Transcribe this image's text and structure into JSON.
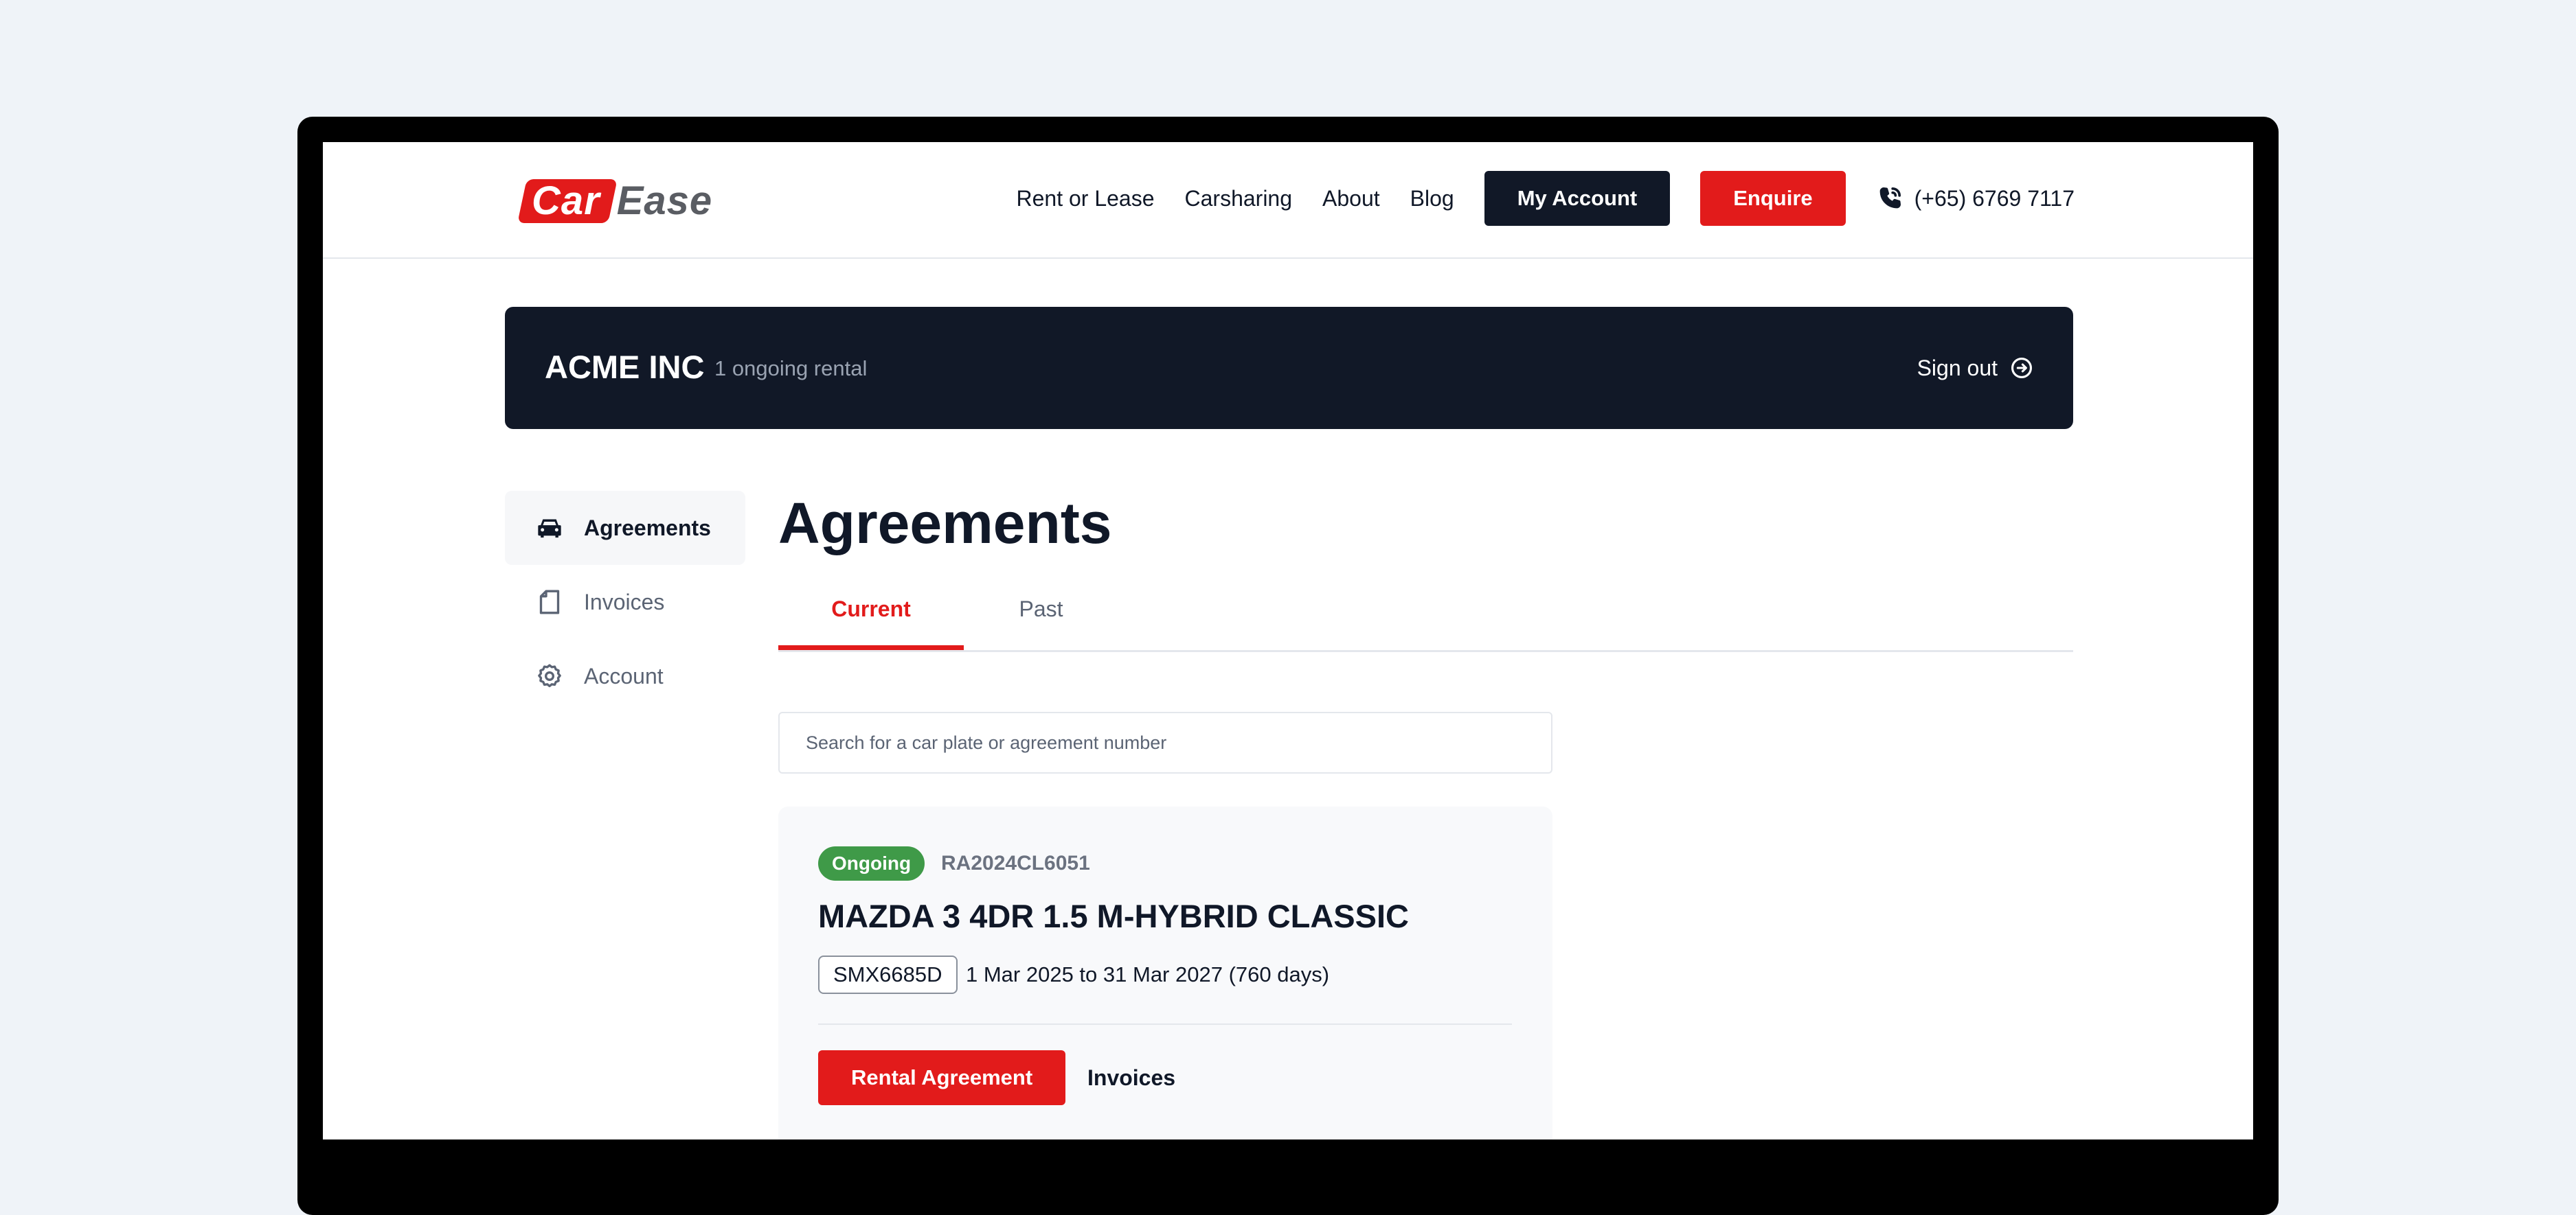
{
  "brand": {
    "logo_part1": "Car",
    "logo_part2": "Ease",
    "primary_color": "#e21b1b",
    "dark_color": "#111827"
  },
  "header": {
    "nav": [
      {
        "label": "Rent or Lease"
      },
      {
        "label": "Carsharing"
      },
      {
        "label": "About"
      },
      {
        "label": "Blog"
      }
    ],
    "my_account_label": "My Account",
    "enquire_label": "Enquire",
    "phone": "(+65) 6769 7117",
    "phone_icon": "phone-icon"
  },
  "account_banner": {
    "company": "ACME INC",
    "rentals_summary": "1 ongoing rental",
    "sign_out_label": "Sign out",
    "sign_out_icon": "arrow-circle-right-icon"
  },
  "sidebar": {
    "items": [
      {
        "label": "Agreements",
        "icon": "car-icon",
        "active": true
      },
      {
        "label": "Invoices",
        "icon": "document-icon",
        "active": false
      },
      {
        "label": "Account",
        "icon": "gear-icon",
        "active": false
      }
    ]
  },
  "main": {
    "title": "Agreements",
    "tabs": [
      {
        "label": "Current",
        "active": true
      },
      {
        "label": "Past",
        "active": false
      }
    ],
    "search": {
      "placeholder": "Search for a car plate or agreement number",
      "value": ""
    },
    "agreements": [
      {
        "status": "Ongoing",
        "status_color": "#3f9a48",
        "agreement_number": "RA2024CL6051",
        "car_model": "MAZDA 3 4DR 1.5 M-HYBRID CLASSIC",
        "plate": "SMX6685D",
        "period": "1 Mar 2025 to 31 Mar 2027 (760 days)",
        "primary_action_label": "Rental Agreement",
        "secondary_action_label": "Invoices"
      }
    ]
  }
}
